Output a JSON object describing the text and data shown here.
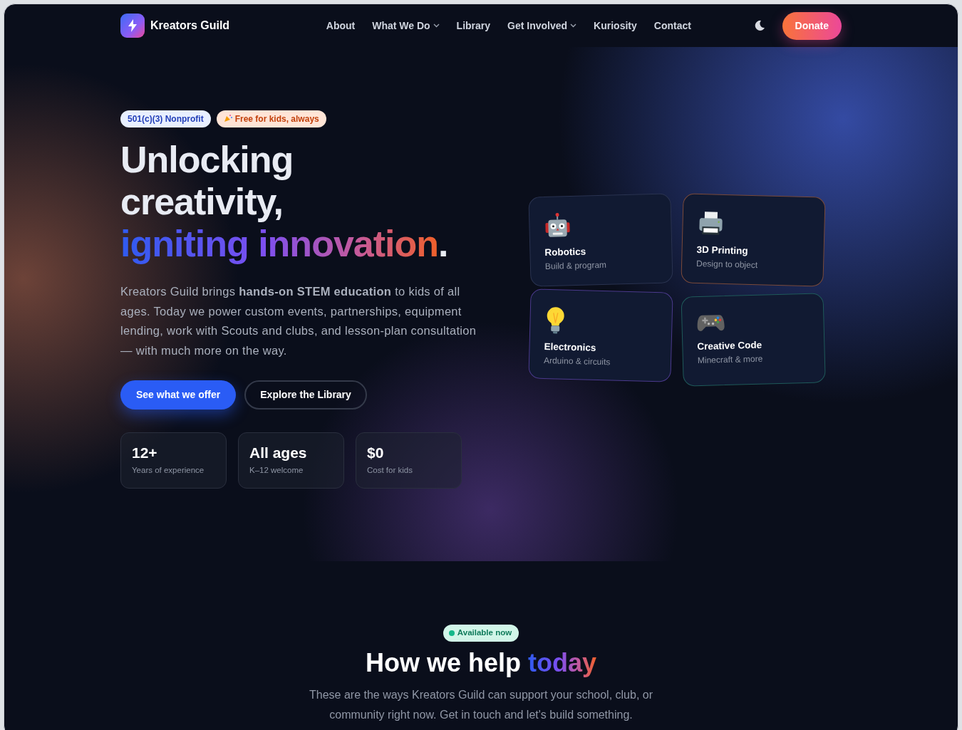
{
  "brand": {
    "name": "Kreators Guild"
  },
  "nav": [
    {
      "label": "About",
      "dropdown": false
    },
    {
      "label": "What We Do",
      "dropdown": true
    },
    {
      "label": "Library",
      "dropdown": false
    },
    {
      "label": "Get Involved",
      "dropdown": true
    },
    {
      "label": "Kuriosity",
      "dropdown": false
    },
    {
      "label": "Contact",
      "dropdown": false
    }
  ],
  "donate": "Donate",
  "badges": [
    {
      "kind": "info",
      "label": "501(c)(3) Nonprofit"
    },
    {
      "kind": "party",
      "label": "Free for kids, always"
    }
  ],
  "headline": {
    "lines": [
      "Unlocking",
      "creativity,"
    ],
    "accent": "igniting innovation",
    "end": "."
  },
  "intro": "Kreators Guild brings **hands-on STEM education** to kids of all ages. Today we power custom events, partnerships, equipment lending, work with Scouts and clubs, and lesson-plan consultation — with much more on the way.",
  "buttons": [
    {
      "kind": "primary",
      "label": "See what we offer"
    },
    {
      "kind": "outline",
      "label": "Explore the Library"
    }
  ],
  "stats": [
    {
      "value": "12+",
      "label": "Years of experience"
    },
    {
      "value": "All ages",
      "label": "K–12 welcome"
    },
    {
      "value": "$0",
      "label": "Cost for kids"
    }
  ],
  "features": [
    {
      "kind": "robot",
      "title": "Robotics",
      "subtitle": "Build & program",
      "color": "#2a3350"
    },
    {
      "kind": "printer",
      "title": "3D Printing",
      "subtitle": "Design to object",
      "color": "#7a4a3a"
    },
    {
      "kind": "bulb",
      "title": "Electronics",
      "subtitle": "Arduino & circuits",
      "color": "#4b3a8c"
    },
    {
      "kind": "gamepad",
      "title": "Creative Code",
      "subtitle": "Minecraft & more",
      "color": "#1f5a5a"
    }
  ],
  "section": {
    "badge": "Available now",
    "title": "How we help",
    "title_accent": "today",
    "text": "These are the ways Kreators Guild can support your school, club, or community right now. Get in touch and let's build something."
  }
}
